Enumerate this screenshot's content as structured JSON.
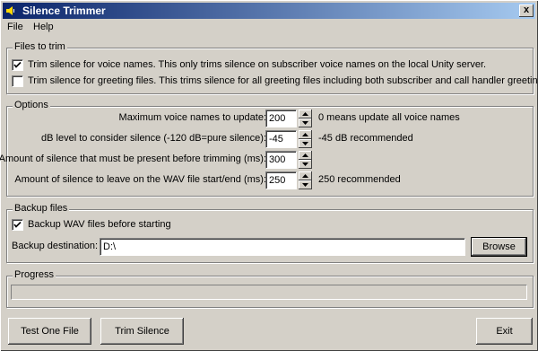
{
  "window": {
    "title": "Silence Trimmer",
    "close_label": "x"
  },
  "menu": {
    "file": "File",
    "help": "Help"
  },
  "files_to_trim": {
    "label": "Files to trim",
    "voice_names": {
      "checked": true,
      "label": "Trim silence for voice names.  This only trims silence on subscriber voice names on the local Unity server."
    },
    "greetings": {
      "checked": false,
      "label": "Trim silence for greeting files.  This trims silence for all greeting files including both subscriber and call handler greetings."
    }
  },
  "options": {
    "label": "Options",
    "max_voice_names": {
      "label": "Maximum voice names to update:",
      "value": "200",
      "hint": "0 means update all voice names"
    },
    "db_level": {
      "label": "dB level to consider silence (-120 dB=pure silence):",
      "value": "-45",
      "hint": "-45 dB recommended"
    },
    "silence_before": {
      "label": "Amount of silence that must be present before trimming (ms):",
      "value": "300",
      "hint": ""
    },
    "silence_leave": {
      "label": "Amount of silence to leave on the WAV file start/end (ms):",
      "value": "250",
      "hint": "250 recommended"
    }
  },
  "backup": {
    "label": "Backup files",
    "checkbox": {
      "checked": true,
      "label": "Backup WAV files before starting"
    },
    "destination_label": "Backup destination:",
    "destination_value": "D:\\",
    "browse_label": "Browse"
  },
  "progress": {
    "label": "Progress",
    "value": 0
  },
  "buttons": {
    "test_one_file": "Test One File",
    "trim_silence": "Trim Silence",
    "exit": "Exit"
  }
}
